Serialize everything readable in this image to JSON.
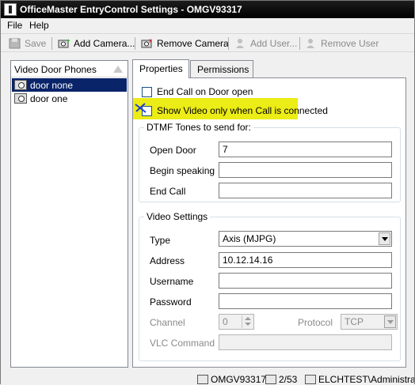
{
  "window": {
    "title": "OfficeMaster EntryControl Settings - OMGV93317"
  },
  "menu": [
    "File",
    "Help"
  ],
  "toolbar": {
    "save": "Save",
    "add_camera": "Add Camera...",
    "remove_camera": "Remove Camera",
    "add_user": "Add User...",
    "remove_user": "Remove User"
  },
  "list": {
    "header": "Video Door Phones",
    "items": [
      "door none",
      "door one"
    ],
    "selected_index": 0
  },
  "tabs": [
    "Properties",
    "Permissions"
  ],
  "properties": {
    "end_call_on_door_open": {
      "label": "End Call on Door open",
      "checked": false
    },
    "show_video_only": {
      "label": "Show Video only when Call is connected",
      "checked": false
    },
    "dtmf": {
      "title": "DTMF Tones to send for:",
      "open_door": {
        "label": "Open Door",
        "value": "7"
      },
      "begin_speaking": {
        "label": "Begin speaking",
        "value": ""
      },
      "end_call": {
        "label": "End Call",
        "value": ""
      }
    },
    "video": {
      "title": "Video Settings",
      "type": {
        "label": "Type",
        "value": "Axis (MJPG)"
      },
      "address": {
        "label": "Address",
        "value": "10.12.14.16"
      },
      "username": {
        "label": "Username",
        "value": ""
      },
      "password": {
        "label": "Password",
        "value": ""
      },
      "channel": {
        "label": "Channel",
        "value": "0"
      },
      "protocol": {
        "label": "Protocol",
        "value": "TCP"
      },
      "vlc_command": {
        "label": "VLC Command",
        "value": ""
      }
    }
  },
  "status": {
    "server": "OMGV93317",
    "count": "2/53",
    "user": "ELCHTEST\\Administrator"
  },
  "colors": {
    "highlight": "#ecec16",
    "selection": "#0a246a",
    "annotation": "#2040d0"
  }
}
